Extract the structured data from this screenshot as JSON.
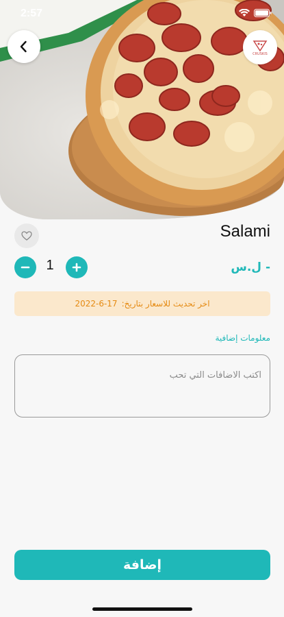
{
  "status_bar": {
    "time": "2:57",
    "icons": [
      "location-arrow-icon",
      "wifi-icon",
      "battery-icon"
    ]
  },
  "header": {
    "back_icon": "chevron-left-icon",
    "logo_text": "CRUSKIS"
  },
  "product": {
    "name": "Salami",
    "quantity": "1",
    "price": "- ل.س",
    "price_update_label": "اخر تحديث للاسعار بتاريخ:",
    "price_update_date": "2022-6-17"
  },
  "extras": {
    "label": "معلومات إضافية",
    "placeholder": "اكتب الاضافات التي تحب"
  },
  "actions": {
    "add_label": "إضافة"
  },
  "colors": {
    "accent": "#1fb8b8",
    "notice_bg": "#fbe8cc",
    "notice_text": "#e58a12"
  }
}
